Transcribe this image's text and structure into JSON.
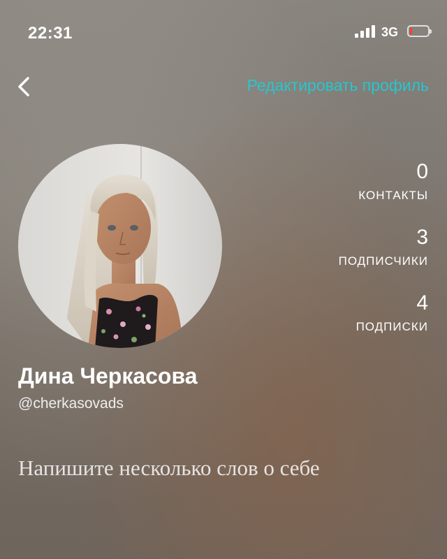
{
  "status_bar": {
    "time": "22:31",
    "network": "3G",
    "signal_icon": "cellular-signal-icon",
    "battery_icon": "battery-low-icon",
    "battery_level": 0.12,
    "battery_color": "#ff3b30"
  },
  "nav": {
    "back_icon": "chevron-left-icon",
    "edit_profile_label": "Редактировать профиль",
    "accent_color": "#26c6cf"
  },
  "profile": {
    "avatar": "profile-photo",
    "name": "Дина Черкасова",
    "handle": "@cherkasovads",
    "bio_placeholder": "Напишите несколько слов о себе"
  },
  "stats": [
    {
      "value": "0",
      "label": "КОНТАКТЫ"
    },
    {
      "value": "3",
      "label": "ПОДПИСЧИКИ"
    },
    {
      "value": "4",
      "label": "ПОДПИСКИ"
    }
  ]
}
